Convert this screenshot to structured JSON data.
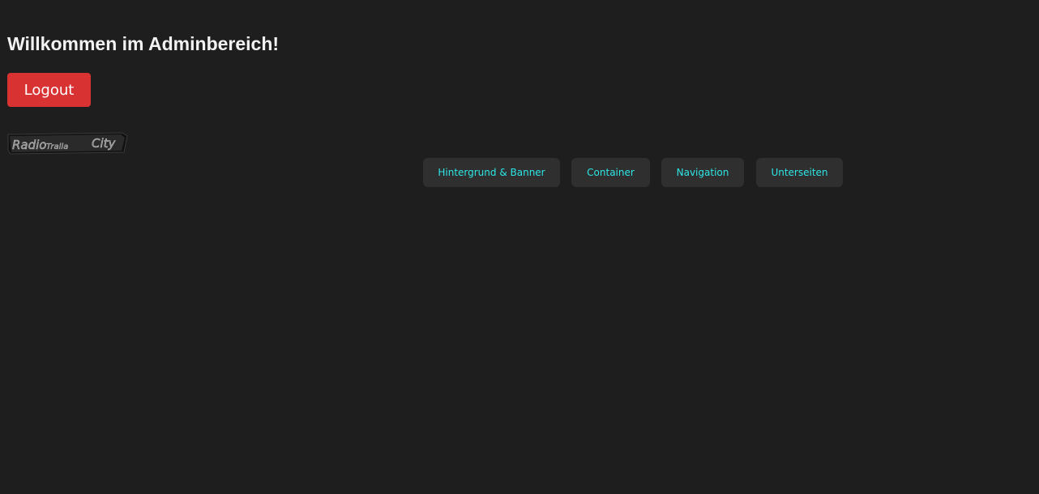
{
  "header": {
    "title": "Willkommen im Adminbereich!"
  },
  "actions": {
    "logout_label": "Logout"
  },
  "logo": {
    "text": "RadioTrallaCity",
    "text_part1": "Radio",
    "text_part2": "Tralla",
    "text_part3": "City"
  },
  "nav": {
    "items": [
      {
        "label": "Hintergrund & Banner"
      },
      {
        "label": "Container"
      },
      {
        "label": "Navigation"
      },
      {
        "label": "Unterseiten"
      }
    ]
  },
  "colors": {
    "background": "#1e1e1e",
    "logout_button": "#d93232",
    "nav_button_bg": "#2f2f2f",
    "nav_button_text": "#2ee6e6"
  }
}
